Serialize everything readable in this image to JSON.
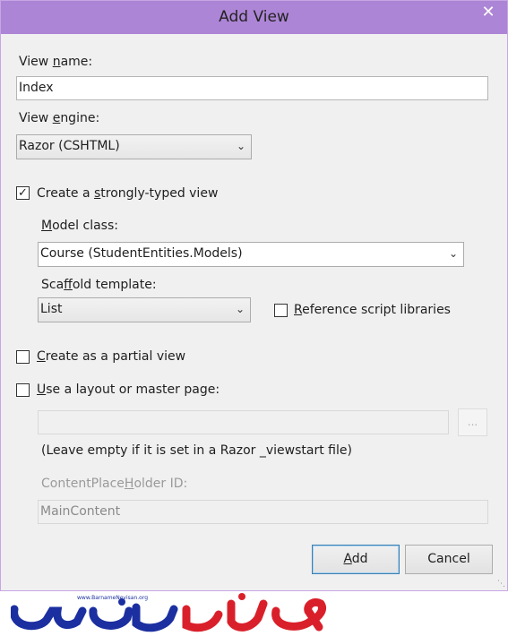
{
  "window": {
    "title": "Add View",
    "close_glyph": "✕"
  },
  "view_name": {
    "label_pre": "View ",
    "label_u": "n",
    "label_post": "ame:",
    "value": "Index"
  },
  "view_engine": {
    "label_pre": "View ",
    "label_u": "e",
    "label_post": "ngine:",
    "selected": "Razor (CSHTML)"
  },
  "strongly_typed": {
    "label_pre": "Create a ",
    "label_u": "s",
    "label_post": "trongly-typed view",
    "checked": true
  },
  "model_class": {
    "label_pre": "",
    "label_u": "M",
    "label_post": "odel class:",
    "selected": "Course (StudentEntities.Models)"
  },
  "scaffold": {
    "label_pre": "Sca",
    "label_u": "f",
    "label_post": "fold template:",
    "selected": "List"
  },
  "reference_scripts": {
    "label_pre": "",
    "label_u": "R",
    "label_post": "eference script libraries",
    "checked": false
  },
  "partial_view": {
    "label_pre": "",
    "label_u": "C",
    "label_post": "reate as a partial view",
    "checked": false
  },
  "layout_page": {
    "label_pre": "",
    "label_u": "U",
    "label_post": "se a layout or master page:",
    "checked": false,
    "value": "",
    "browse_label": "..."
  },
  "hint": "(Leave empty if it is set in a Razor _viewstart file)",
  "placeholder_id": {
    "label_pre": "ContentPlace",
    "label_u": "H",
    "label_post": "older ID:",
    "value": "MainContent"
  },
  "buttons": {
    "add": {
      "label_pre": "",
      "label_u": "A",
      "label_post": "dd"
    },
    "cancel": {
      "label": "Cancel"
    }
  },
  "watermark": {
    "url_text": "www.BarnameNevisan.org"
  },
  "colors": {
    "titlebar": "#ad85d6",
    "dialog_bg": "#f0f0f0",
    "logo_blue": "#1b2fa0",
    "logo_red": "#d9202a"
  }
}
